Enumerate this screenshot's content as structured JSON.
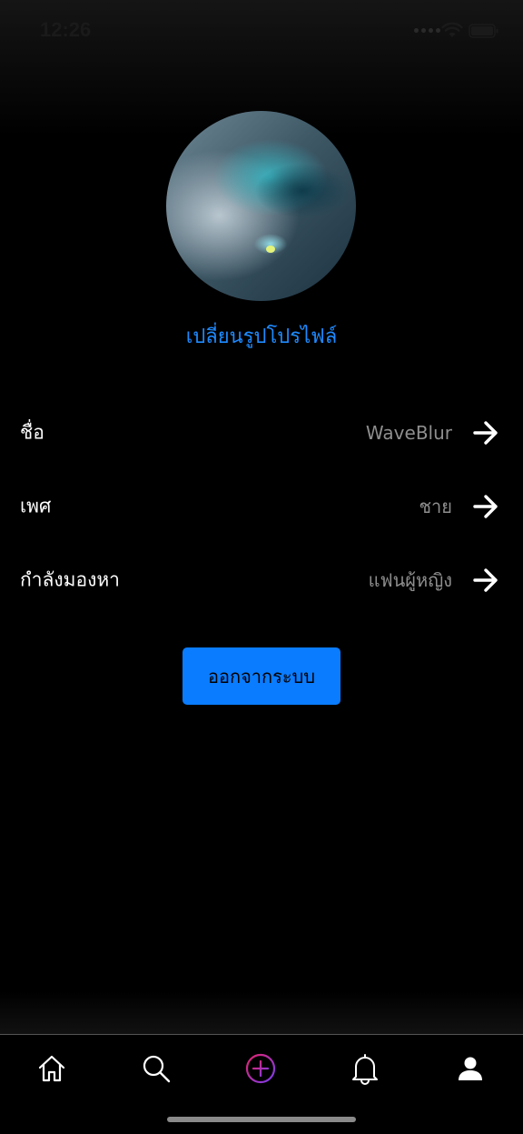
{
  "status_bar": {
    "time": "12:26"
  },
  "profile": {
    "change_photo_label": "เปลี่ยนรูปโปรไฟล์"
  },
  "rows": [
    {
      "label": "ชื่อ",
      "value": "WaveBlur",
      "icon": "arrow-right-icon"
    },
    {
      "label": "เพศ",
      "value": "ชาย",
      "icon": "arrow-right-icon"
    },
    {
      "label": "กำลังมองหา",
      "value": "แฟนผู้หญิง",
      "icon": "arrow-right-icon"
    }
  ],
  "logout_label": "ออกจากระบบ",
  "tab_bar": {
    "tabs": [
      {
        "name": "home",
        "icon": "home-icon"
      },
      {
        "name": "search",
        "icon": "search-icon"
      },
      {
        "name": "add",
        "icon": "plus-circle-icon"
      },
      {
        "name": "notifications",
        "icon": "bell-icon"
      },
      {
        "name": "profile",
        "icon": "person-icon",
        "active": true
      }
    ]
  },
  "colors": {
    "accent": "#0a7cff",
    "link": "#1e8aff",
    "muted": "#8e8e8e",
    "add_gradient_start": "#e0246b",
    "add_gradient_end": "#7a3cf0"
  }
}
